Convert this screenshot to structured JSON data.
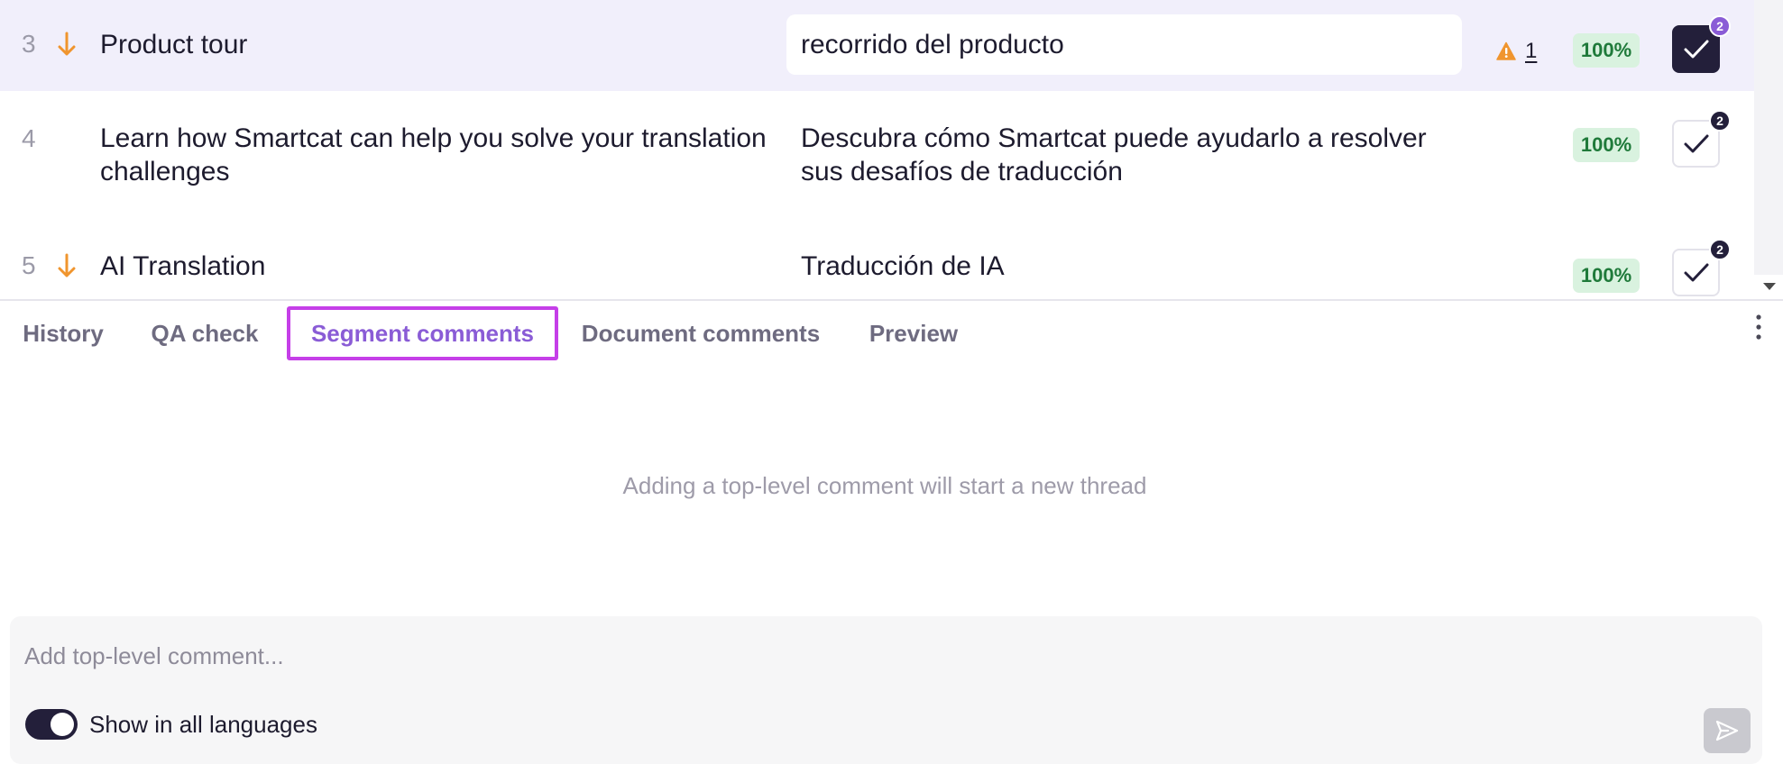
{
  "segments": [
    {
      "number": "3",
      "source": "Product tour",
      "target": "recorrido del producto",
      "match": "100%",
      "warning_count": "1",
      "comment_badge": "2",
      "has_arrow": true,
      "active": true,
      "confirmed_filled": true
    },
    {
      "number": "4",
      "source": "Learn how Smartcat can help you solve your translation challenges",
      "target": "Descubra cómo Smartcat puede ayudarlo a resolver sus desafíos de traducción",
      "match": "100%",
      "comment_badge": "2",
      "has_arrow": false,
      "active": false,
      "confirmed_filled": false
    },
    {
      "number": "5",
      "source": "AI Translation",
      "target": "Traducción de IA",
      "match": "100%",
      "comment_badge": "2",
      "has_arrow": true,
      "active": false,
      "confirmed_filled": false
    }
  ],
  "panel": {
    "tabs": [
      {
        "label": "History"
      },
      {
        "label": "QA check"
      },
      {
        "label": "Segment comments",
        "selected": true
      },
      {
        "label": "Document comments"
      },
      {
        "label": "Preview"
      }
    ],
    "empty_message": "Adding a top-level comment will start a new thread",
    "comment": {
      "placeholder": "Add top-level comment...",
      "value": "",
      "toggle_label": "Show in all languages",
      "toggle_on": true
    }
  },
  "icons": {
    "arrow": "arrow-down-icon",
    "warning": "warning-icon",
    "confirm": "check-icon",
    "more": "more-vertical-icon",
    "send": "send-icon"
  },
  "colors": {
    "accent": "#8a5cd6",
    "tab_highlight": "#c53fe8",
    "active_row": "#f1effb",
    "match_bg": "#d9f2df",
    "match_text": "#1f7a3a",
    "warning": "#f0952e",
    "arrow": "#f0952e",
    "dark": "#231f3a"
  }
}
